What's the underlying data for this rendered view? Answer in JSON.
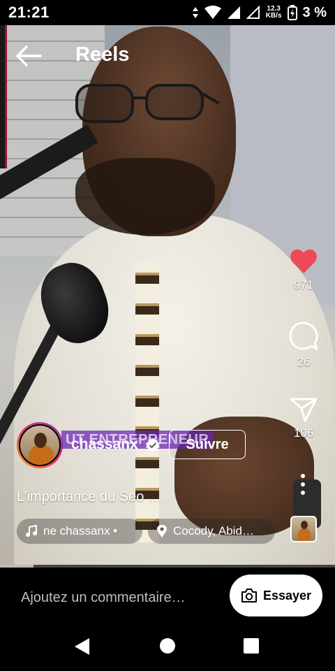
{
  "status_bar": {
    "time": "21:21",
    "net_speed_value": "12.3",
    "net_speed_unit": "KB/s",
    "battery": "3 %"
  },
  "header": {
    "title": "Reels",
    "back_icon": "arrow-left-icon"
  },
  "actions": {
    "likes": "971",
    "comments": "26",
    "shares": "106",
    "like_color": "#ed4956"
  },
  "author": {
    "brand_overlay": "UT ENTREPRENEUR",
    "username": "chassanx",
    "follow_label": "Suivre"
  },
  "caption": "L’importance du Seo …",
  "audio_pill": {
    "text": "ne   chassanx •"
  },
  "location_pill": {
    "text": "Cocody, Abid…"
  },
  "progress": {
    "fraction": 0.1
  },
  "comment_bar": {
    "placeholder": "Ajoutez un commentaire…",
    "try_label": "Essayer"
  }
}
